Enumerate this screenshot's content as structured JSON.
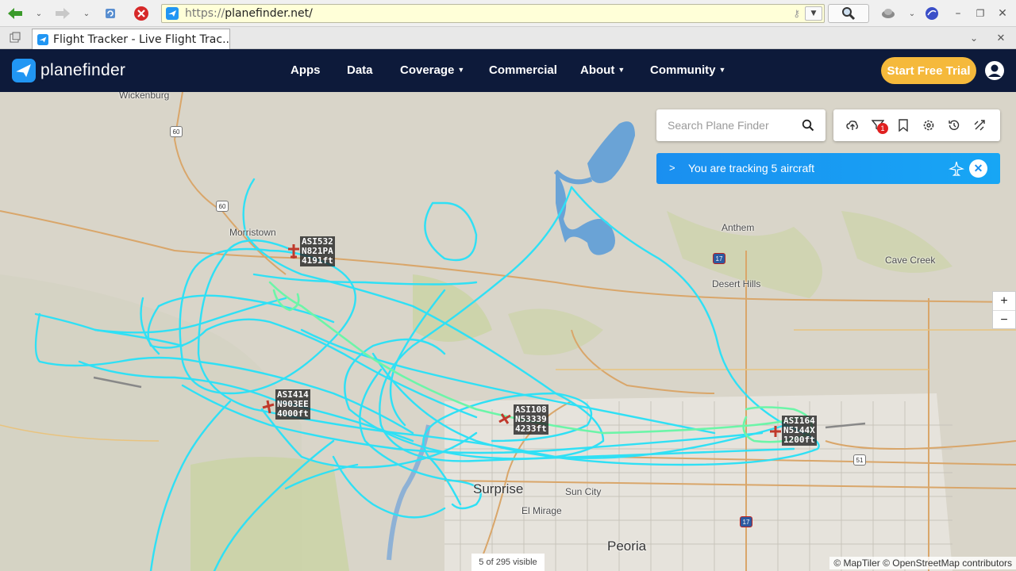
{
  "browser": {
    "url_scheme": "https://",
    "url_host": "planefinder.net/",
    "tab_title": "Flight Tracker - Live Flight Trac..."
  },
  "site": {
    "logo_text": "planefinder",
    "menu": [
      {
        "label": "Apps"
      },
      {
        "label": "Data"
      },
      {
        "label": "Coverage"
      },
      {
        "label": "Commercial"
      },
      {
        "label": "About"
      },
      {
        "label": "Community"
      }
    ],
    "trial_label": "Start Free Trial"
  },
  "map": {
    "search_placeholder": "Search Plane Finder",
    "alerts_badge": "1",
    "tracking_text": "You are tracking 5 aircraft",
    "zoom_in": "+",
    "zoom_out": "−",
    "visible_count": "5 of 295 visible",
    "attribution": "© MapTiler © OpenStreetMap contributors",
    "places": {
      "wickenburg": "Wickenburg",
      "morristown": "Morristown",
      "anthem": "Anthem",
      "cave_creek": "Cave Creek",
      "desert_hills": "Desert Hills",
      "surprise": "Surprise",
      "sun_city": "Sun City",
      "el_mirage": "El Mirage",
      "peoria": "Peoria"
    },
    "highways": {
      "h60a": "60",
      "h60b": "60",
      "i17a": "17",
      "i17b": "17",
      "h51": "51"
    },
    "aircraft": [
      {
        "callsign": "ASI532",
        "reg": "N821PA",
        "alt": "4191ft"
      },
      {
        "callsign": "ASI414",
        "reg": "N903EE",
        "alt": "4000ft"
      },
      {
        "callsign": "ASI108",
        "reg": "N53339",
        "alt": "4233ft"
      },
      {
        "callsign": "ASI164",
        "reg": "N5144X",
        "alt": "1200ft"
      }
    ],
    "colors": {
      "track": "#2fe0f5",
      "track_low": "#6cf5a8",
      "aircraft": "#c0392b",
      "water": "#6aa3d6",
      "park": "#c9d3a4"
    }
  }
}
